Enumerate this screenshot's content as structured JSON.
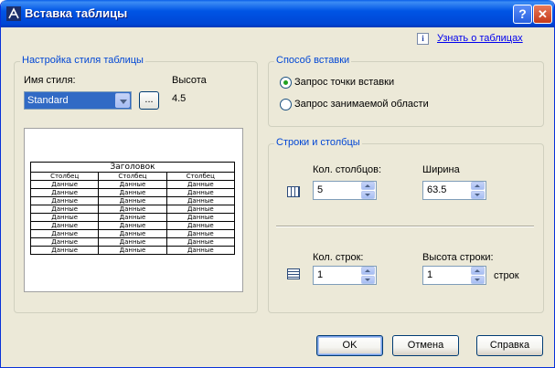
{
  "window": {
    "title": "Вставка таблицы",
    "help_glyph": "?",
    "close_glyph": "✕"
  },
  "link": {
    "icon_glyph": "i",
    "text": "Узнать о таблицах"
  },
  "style_group": {
    "legend": "Настройка стиля таблицы",
    "style_name_label": "Имя стиля:",
    "style_name_value": "Standard",
    "browse_label": "...",
    "height_label": "Высота",
    "height_value": "4.5"
  },
  "preview": {
    "title": "Заголовок",
    "headers": [
      "Столбец",
      "Столбец",
      "Столбец"
    ],
    "rows": [
      [
        "Данные",
        "Данные",
        "Данные"
      ],
      [
        "Данные",
        "Данные",
        "Данные"
      ],
      [
        "Данные",
        "Данные",
        "Данные"
      ],
      [
        "Данные",
        "Данные",
        "Данные"
      ],
      [
        "Данные",
        "Данные",
        "Данные"
      ],
      [
        "Данные",
        "Данные",
        "Данные"
      ],
      [
        "Данные",
        "Данные",
        "Данные"
      ],
      [
        "Данные",
        "Данные",
        "Данные"
      ],
      [
        "Данные",
        "Данные",
        "Данные"
      ]
    ]
  },
  "insert_group": {
    "legend": "Способ вставки",
    "options": [
      {
        "label": "Запрос точки вставки",
        "selected": true
      },
      {
        "label": "Запрос занимаемой области",
        "selected": false
      }
    ]
  },
  "rowscols_group": {
    "legend": "Строки и столбцы",
    "columns_label": "Кол. столбцов:",
    "columns_value": "5",
    "width_label": "Ширина",
    "width_value": "63.5",
    "rows_label": "Кол. строк:",
    "rows_value": "1",
    "row_height_label": "Высота строки:",
    "row_height_value": "1",
    "row_height_unit": "строк"
  },
  "buttons": {
    "ok": "OK",
    "cancel": "Отмена",
    "help": "Справка"
  },
  "colors": {
    "titlebar": "#0055E5",
    "dialog_bg": "#ECE9D8",
    "legend_text": "#0046D5",
    "selection": "#316AC5",
    "radio_dot": "#21A121"
  }
}
